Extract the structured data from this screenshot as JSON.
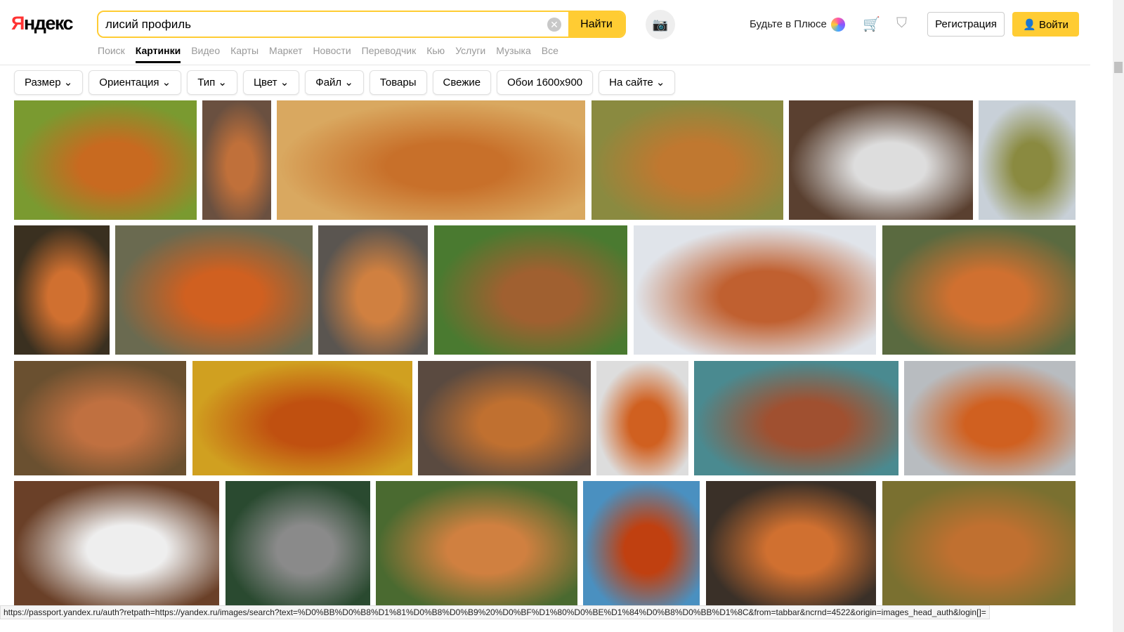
{
  "logo": {
    "first": "Я",
    "rest": "ндекс"
  },
  "search": {
    "value": "лисий профиль",
    "button": "Найти"
  },
  "header": {
    "plus": "Будьте в Плюсе",
    "register": "Регистрация",
    "login": "Войти"
  },
  "tabs": [
    "Поиск",
    "Картинки",
    "Видео",
    "Карты",
    "Маркет",
    "Новости",
    "Переводчик",
    "Кью",
    "Услуги",
    "Музыка",
    "Все"
  ],
  "filters": [
    "Размер ⌄",
    "Ориентация ⌄",
    "Тип ⌄",
    "Цвет ⌄",
    "Файл ⌄",
    "Товары",
    "Свежие",
    "Обои 1600x900",
    "На сайте ⌄"
  ],
  "status_url": "https://passport.yandex.ru/auth?retpath=https://yandex.ru/images/search?text=%D0%BB%D0%B8%D1%81%D0%B8%D0%B9%20%D0%BF%D1%80%D0%BE%D1%84%D0%B8%D0%BB%D1%8C&from=tabbar&ncrnd=4522&origin=images_head_auth&login[]="
}
